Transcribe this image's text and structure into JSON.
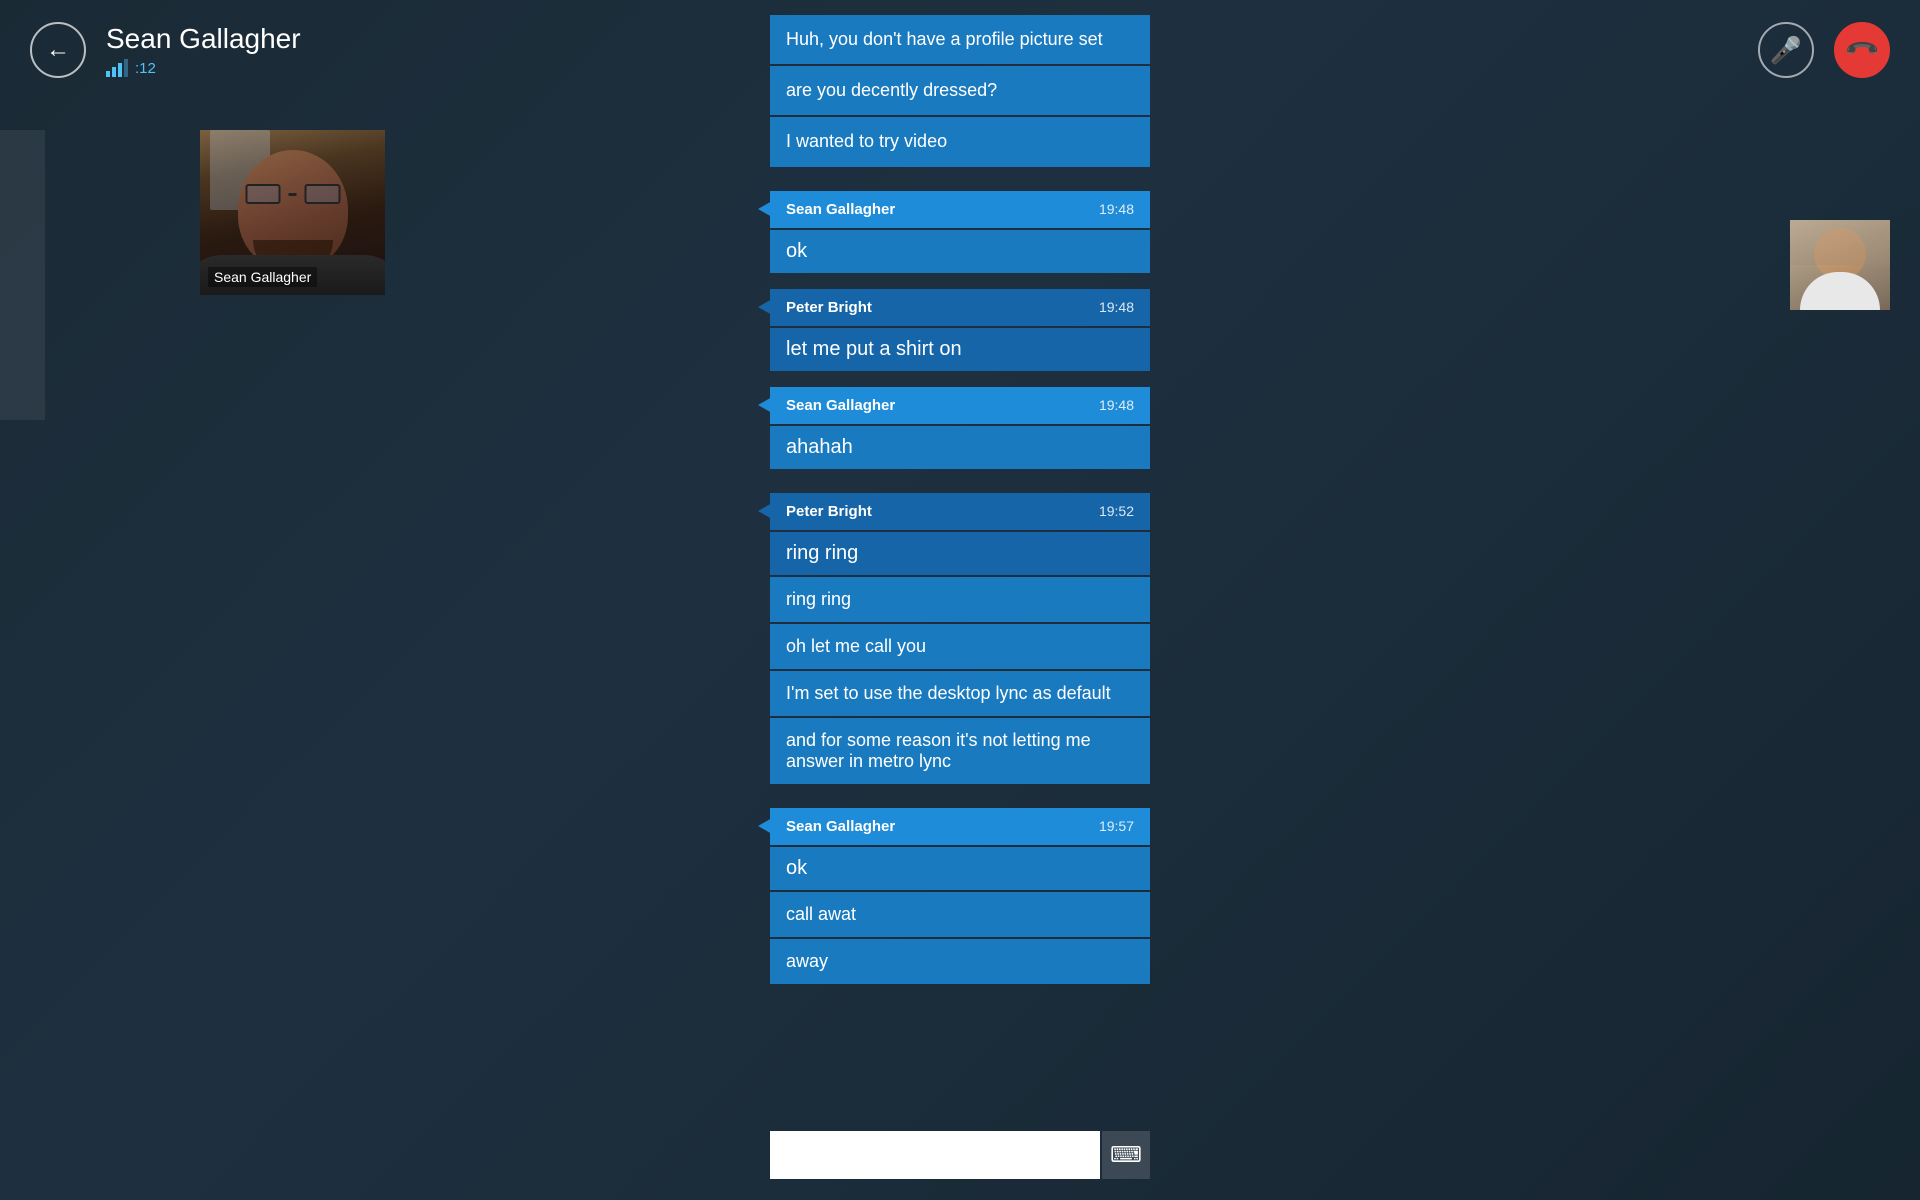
{
  "header": {
    "contact_name": "Sean Gallagher",
    "signal_bars": 3,
    "signal_count": ":12",
    "mic_icon": "🎤",
    "end_call_icon": "📞"
  },
  "video": {
    "left_label": "Sean Gallagher",
    "right_label": ""
  },
  "messages": [
    {
      "id": "m1",
      "type": "standalone",
      "text": "Huh, you don't have a profile picture set",
      "sender": null,
      "time": null
    },
    {
      "id": "m2",
      "type": "standalone",
      "text": "are you decently dressed?",
      "sender": null,
      "time": null
    },
    {
      "id": "m3",
      "type": "standalone",
      "text": "I wanted to try video",
      "sender": null,
      "time": null
    },
    {
      "id": "m4",
      "type": "header+body",
      "sender": "Sean Gallagher",
      "time": "19:48",
      "text": "ok"
    },
    {
      "id": "m5",
      "type": "header+body",
      "sender": "Peter Bright",
      "time": "19:48",
      "text": "let me put a shirt on",
      "style": "peter"
    },
    {
      "id": "m6",
      "type": "header+body",
      "sender": "Sean Gallagher",
      "time": "19:48",
      "text": "ahahah"
    },
    {
      "id": "m7",
      "type": "header+body",
      "sender": "Peter Bright",
      "time": "19:52",
      "text": "ring ring",
      "style": "peter"
    },
    {
      "id": "m8",
      "type": "standalone",
      "text": "ring ring"
    },
    {
      "id": "m9",
      "type": "standalone",
      "text": "oh let me call you"
    },
    {
      "id": "m10",
      "type": "standalone",
      "text": "I'm set to use the desktop lync as default"
    },
    {
      "id": "m11",
      "type": "standalone",
      "text": "and for some reason it's not letting me answer in metro lync"
    },
    {
      "id": "m12",
      "type": "header+body",
      "sender": "Sean Gallagher",
      "time": "19:57",
      "text": "ok"
    },
    {
      "id": "m13",
      "type": "standalone",
      "text": "call awat"
    },
    {
      "id": "m14",
      "type": "standalone",
      "text": "away"
    }
  ],
  "input": {
    "placeholder": "",
    "keyboard_icon": "⌨"
  }
}
